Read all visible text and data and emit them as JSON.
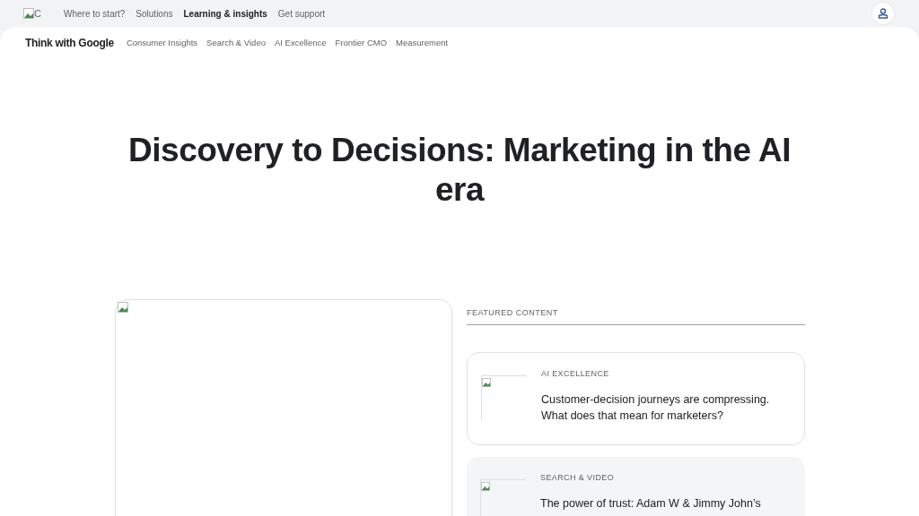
{
  "top_nav": {
    "logo_alt": "C",
    "items": [
      {
        "label": "Where to start?",
        "selected": false
      },
      {
        "label": "Solutions",
        "selected": false
      },
      {
        "label": "Learning & insights",
        "selected": true
      },
      {
        "label": "Get support",
        "selected": false
      }
    ]
  },
  "sub_nav": {
    "brand": "Think with Google",
    "items": [
      "Consumer Insights",
      "Search & Video",
      "AI Excellence",
      "Frontier CMO",
      "Measurement"
    ]
  },
  "headline": "Discovery to Decisions: Marketing in the AI era",
  "featured": {
    "heading": "FEATURED CONTENT",
    "cards": [
      {
        "category": "AI EXCELLENCE",
        "title": "Customer-decision journeys are compressing. What does that mean for marketers?",
        "selected": false
      },
      {
        "category": "SEARCH & VIDEO",
        "title": "The power of trust: Adam W & Jimmy John’s",
        "selected": true
      }
    ]
  }
}
